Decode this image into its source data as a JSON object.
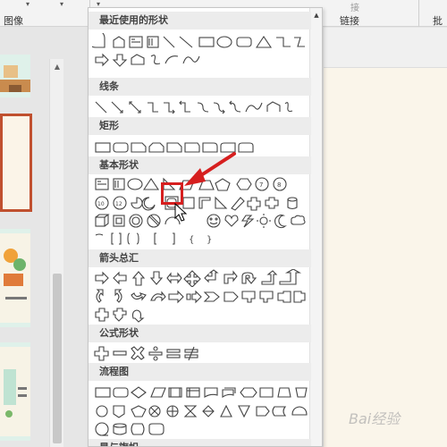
{
  "ribbon": {
    "image_label": "图像",
    "link_label": "链接",
    "batch_label": "批",
    "partial_label": "接"
  },
  "shapes_panel": {
    "sections": [
      {
        "title": "最近使用的形状"
      },
      {
        "title": "线条"
      },
      {
        "title": "矩形"
      },
      {
        "title": "基本形状"
      },
      {
        "title": "箭头总汇"
      },
      {
        "title": "公式形状"
      },
      {
        "title": "流程图"
      },
      {
        "title": "星与旗帜"
      }
    ],
    "selected_shape": "rounded-square-in-frame"
  },
  "annotation": {
    "highlight_color": "#d61f1f"
  },
  "watermark": {
    "text": "Bai经验"
  }
}
